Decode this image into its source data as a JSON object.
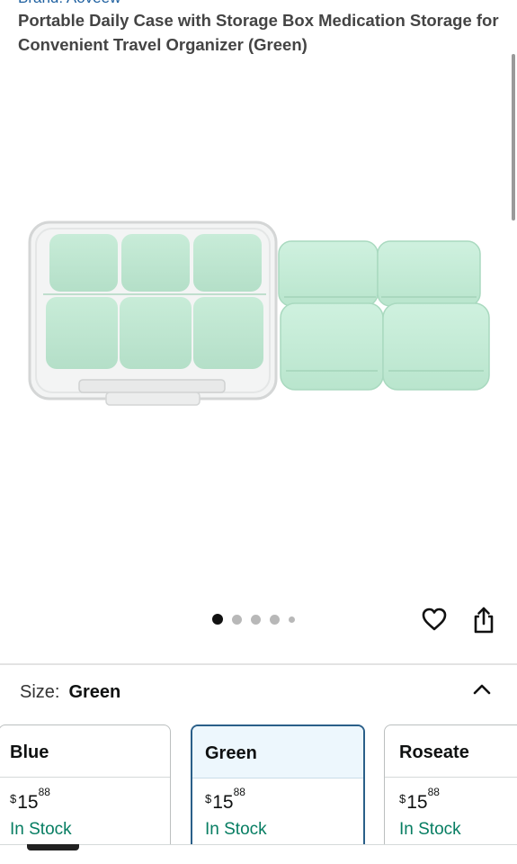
{
  "product": {
    "brand_line": "Brand: Aoveew",
    "title": "Portable Daily Case with Storage Box Medication Storage for Convenient Travel Organizer (Green)"
  },
  "gallery": {
    "image_count": 5,
    "active_index": 0,
    "icons": [
      "heart-icon",
      "share-icon"
    ]
  },
  "size_selector": {
    "label": "Size:",
    "selected": "Green",
    "toggle_icon": "chevron-up-icon"
  },
  "options": [
    {
      "name": "Blue",
      "price_symbol": "$",
      "price_whole": "15",
      "price_fraction": "88",
      "availability": "In Stock"
    },
    {
      "name": "Green",
      "price_symbol": "$",
      "price_whole": "15",
      "price_fraction": "88",
      "availability": "In Stock"
    },
    {
      "name": "Roseate",
      "price_symbol": "$",
      "price_whole": "15",
      "price_fraction": "88",
      "availability": "In Stock"
    }
  ],
  "colors": {
    "link_blue": "#2162a1",
    "in_stock_green": "#067d62",
    "selected_border": "#2a5f89",
    "selected_bg": "#edf7fd",
    "product_mint": "#c6ecd8"
  }
}
